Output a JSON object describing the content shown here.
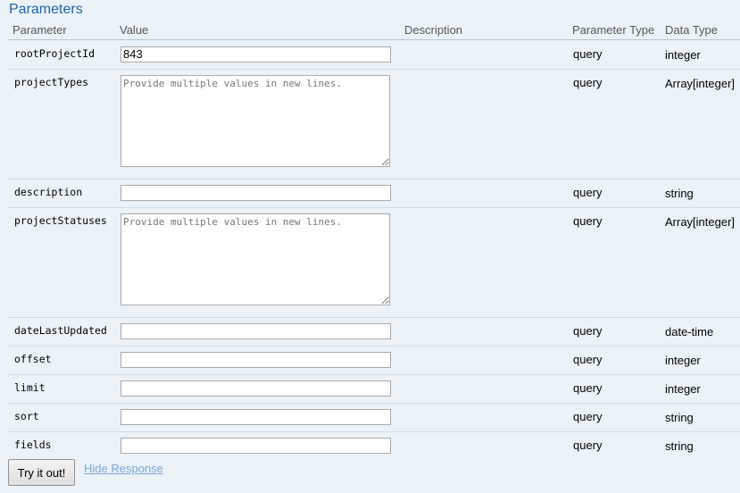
{
  "section_title": "Parameters",
  "headers": {
    "parameter": "Parameter",
    "value": "Value",
    "description": "Description",
    "parameter_type": "Parameter Type",
    "data_type": "Data Type"
  },
  "params": [
    {
      "name": "rootProjectId",
      "value": "843",
      "placeholder": "",
      "param_type": "query",
      "data_type": "integer"
    },
    {
      "name": "projectTypes",
      "value": "",
      "placeholder": "Provide multiple values in new lines.",
      "param_type": "query",
      "data_type": "Array[integer]"
    },
    {
      "name": "description",
      "value": "",
      "placeholder": "",
      "param_type": "query",
      "data_type": "string"
    },
    {
      "name": "projectStatuses",
      "value": "",
      "placeholder": "Provide multiple values in new lines.",
      "param_type": "query",
      "data_type": "Array[integer]"
    },
    {
      "name": "dateLastUpdated",
      "value": "",
      "placeholder": "",
      "param_type": "query",
      "data_type": "date-time"
    },
    {
      "name": "offset",
      "value": "",
      "placeholder": "",
      "param_type": "query",
      "data_type": "integer"
    },
    {
      "name": "limit",
      "value": "",
      "placeholder": "",
      "param_type": "query",
      "data_type": "integer"
    },
    {
      "name": "sort",
      "value": "",
      "placeholder": "",
      "param_type": "query",
      "data_type": "string"
    },
    {
      "name": "fields",
      "value": "",
      "placeholder": "",
      "param_type": "query",
      "data_type": "string"
    }
  ],
  "try_button_label": "Try it out!",
  "hide_response_label": "Hide Response"
}
